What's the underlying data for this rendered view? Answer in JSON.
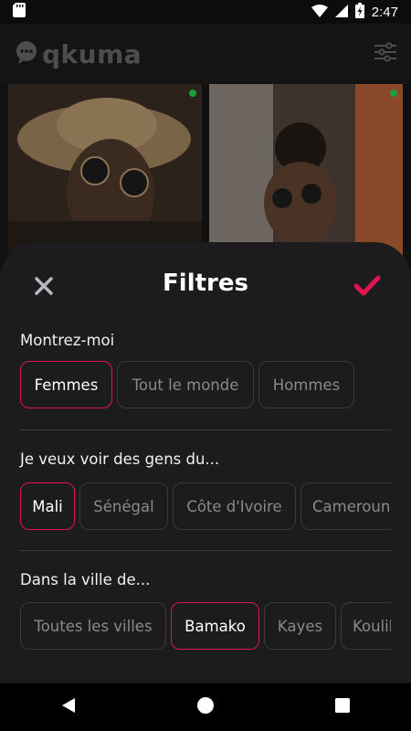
{
  "status_bar": {
    "time": "2:47"
  },
  "app": {
    "brand_name": "qkuma"
  },
  "filters": {
    "title": "Filtres",
    "show_me": {
      "label": "Montrez-moi",
      "options": [
        "Femmes",
        "Tout le monde",
        "Hommes"
      ],
      "selected": "Femmes"
    },
    "country": {
      "label": "Je veux voir des gens du...",
      "options": [
        "Mali",
        "Sénégal",
        "Côte d'Ivoire",
        "Cameroun"
      ],
      "selected": "Mali"
    },
    "city": {
      "label": "Dans la ville de...",
      "options": [
        "Toutes les villes",
        "Bamako",
        "Kayes",
        "Koulikoro"
      ],
      "selected": "Bamako"
    }
  },
  "colors": {
    "accent": "#e0144f",
    "online": "#1e9e3a",
    "sheet": "#1c1c1e"
  }
}
